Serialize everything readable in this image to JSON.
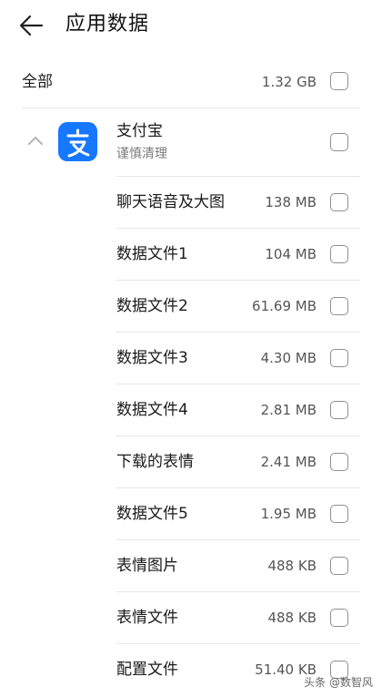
{
  "header": {
    "title": "应用数据",
    "back_icon": "back-arrow-icon"
  },
  "all_row": {
    "label": "全部",
    "size": "1.32 GB",
    "checked": false
  },
  "app": {
    "name": "支付宝",
    "subtitle": "谨慎清理",
    "icon": "alipay-icon",
    "icon_color": "#1677ff",
    "expanded": true,
    "checked": false
  },
  "items": [
    {
      "label": "聊天语音及大图",
      "size": "138 MB",
      "checked": false
    },
    {
      "label": "数据文件1",
      "size": "104 MB",
      "checked": false
    },
    {
      "label": "数据文件2",
      "size": "61.69 MB",
      "checked": false
    },
    {
      "label": "数据文件3",
      "size": "4.30 MB",
      "checked": false
    },
    {
      "label": "数据文件4",
      "size": "2.81 MB",
      "checked": false
    },
    {
      "label": "下载的表情",
      "size": "2.41 MB",
      "checked": false
    },
    {
      "label": "数据文件5",
      "size": "1.95 MB",
      "checked": false
    },
    {
      "label": "表情图片",
      "size": "488 KB",
      "checked": false
    },
    {
      "label": "表情文件",
      "size": "488 KB",
      "checked": false
    },
    {
      "label": "配置文件",
      "size": "51.40 KB",
      "checked": false
    }
  ],
  "watermark": "头条 @数智风"
}
